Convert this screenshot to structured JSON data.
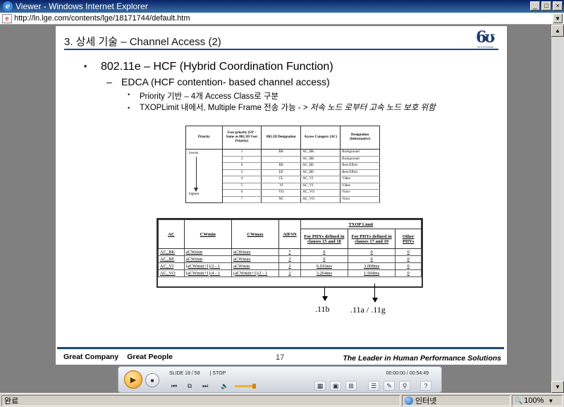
{
  "window": {
    "title": "Viewer - Windows Internet Explorer",
    "url": "http://ln.lge.com/contents/lge/18171744/default.htm",
    "ie_icon": "e",
    "page_icon": "e",
    "buttons": {
      "minimize": "_",
      "maximize": "□",
      "close": "×",
      "dropdown": "▼"
    }
  },
  "slide": {
    "title": "3. 상세 기술 – Channel Access (2)",
    "logo": "6ʊ",
    "logo_sub": "SIXSIGMA",
    "bullet1": "802.11e – HCF (Hybrid Coordination Function)",
    "bullet2": "EDCA (HCF contention- based channel access)",
    "bullet3a": "Priority 기반 – 4개 Access Class로 구분",
    "bullet3b_plain": "TXOPLimit 내에서, Multiple Frame 전송 가능 - > ",
    "bullet3b_italic": "저속 노드 로부터 고속 노드 보호 위함",
    "markers": {
      "dot": "•",
      "dash": "–"
    },
    "table1": {
      "headers": [
        "Priority",
        "User priority (UP – Same as 802.1D User Priority)",
        "802.1D Designation",
        "Access Category (AC)",
        "Designation (Informative)"
      ],
      "priority_low": "lowest",
      "priority_high": "highest",
      "rows": [
        [
          "1",
          "BK",
          "AC_BK",
          "Background"
        ],
        [
          "2",
          "–",
          "AC_BK",
          "Background"
        ],
        [
          "0",
          "BE",
          "AC_BE",
          "Best Effort"
        ],
        [
          "3",
          "EE",
          "AC_BE",
          "Best Effort"
        ],
        [
          "4",
          "CL",
          "AC_VI",
          "Video"
        ],
        [
          "5",
          "VI",
          "AC_VI",
          "Video"
        ],
        [
          "6",
          "VO",
          "AC_VO",
          "Voice"
        ],
        [
          "7",
          "NC",
          "AC_VO",
          "Voice"
        ]
      ]
    },
    "table2": {
      "headers": [
        "AC",
        "CWmin",
        "CWmax",
        "AIFSN"
      ],
      "txop_header": "TXOP Limit",
      "txop_sub": [
        "For PHYs defined in clauses 15 and 18",
        "For PHYs defined in clauses 17 and 19",
        "Other PHYs"
      ],
      "rows": [
        [
          "AC_BK",
          "aCWmin",
          "aCWmax",
          "7",
          "0",
          "0",
          "0"
        ],
        [
          "AC_BE",
          "aCWmin",
          "aCWmax",
          "3",
          "0",
          "0",
          "0"
        ],
        [
          "AC_VI",
          "(aCWmin+1)/2 - 1",
          "aCWmin",
          "2",
          "6.016ms",
          "3.008ms",
          "0"
        ],
        [
          "AC_VO",
          "(aCWmin+1)/4 - 1",
          "(aCWmin+1)/2 - 1",
          "2",
          "3.264ms",
          "1.504ms",
          "0"
        ]
      ]
    },
    "annotation1": ".11b",
    "annotation2": ".11a / .11g",
    "footer_left_1": "Great Company",
    "footer_left_2": "Great People",
    "page_number": "17",
    "footer_right": "The Leader in Human Performance Solutions"
  },
  "player": {
    "play_icon": "▶",
    "stop_icon": "■",
    "slide_label": "SLIDE 18 / 58",
    "state": "| STOP",
    "time": "00:00:00 / 00:54:49",
    "icons": {
      "prev": "⏮",
      "copy": "⧉",
      "next": "⏭",
      "volume": "🔈",
      "i1": "▦",
      "i2": "▣",
      "i3": "⊞",
      "i4": "☰",
      "i5": "✎",
      "i6": "⚲",
      "help": "?"
    }
  },
  "statusbar": {
    "status": "완료",
    "zone": "인터넷",
    "zoom": "100%",
    "zoom_icon": "🔍",
    "zoom_dd": "▼"
  }
}
